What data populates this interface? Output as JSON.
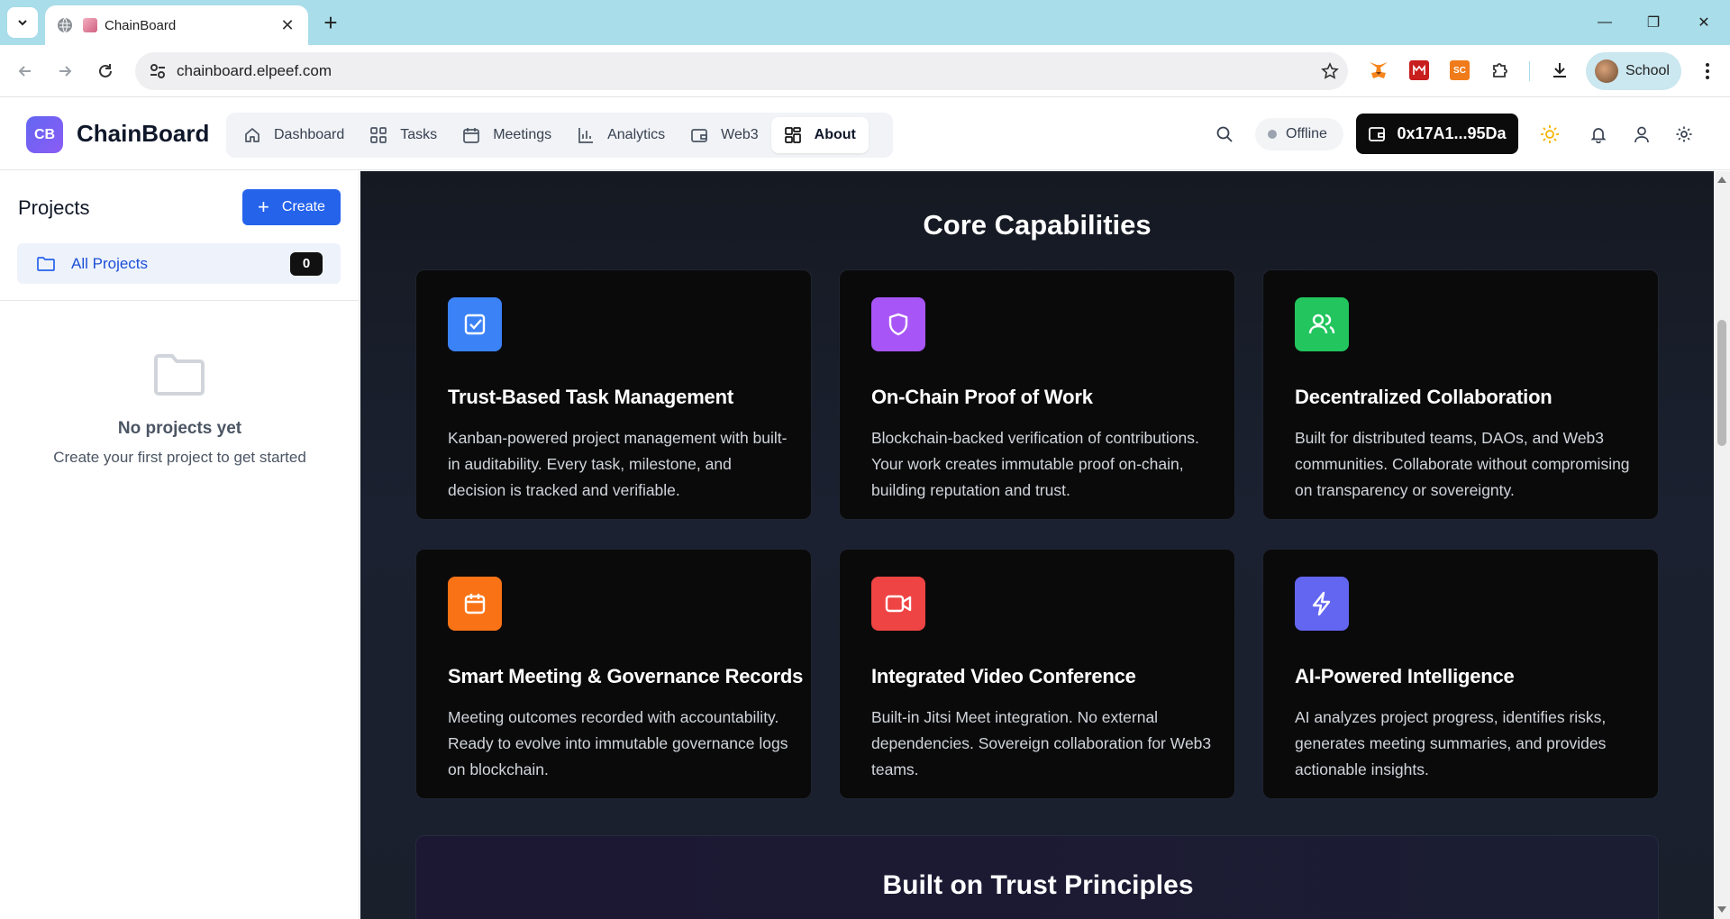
{
  "browser": {
    "tab_title": "ChainBoard",
    "url": "chainboard.elpeef.com",
    "profile_name": "School",
    "extensions": [
      {
        "name": "metamask-extension-icon",
        "label": ""
      },
      {
        "name": "red-extension-icon",
        "label": ""
      },
      {
        "name": "sc-extension-icon",
        "label": "SC"
      }
    ]
  },
  "header": {
    "logo_text": "CB",
    "brand": "ChainBoard",
    "nav": [
      {
        "label": "Dashboard",
        "icon": "home-icon"
      },
      {
        "label": "Tasks",
        "icon": "grid-icon"
      },
      {
        "label": "Meetings",
        "icon": "calendar-icon"
      },
      {
        "label": "Analytics",
        "icon": "bar-chart-icon"
      },
      {
        "label": "Web3",
        "icon": "wallet-icon"
      },
      {
        "label": "About",
        "icon": "layout-icon",
        "active": true
      }
    ],
    "status": "Offline",
    "wallet": "0x17A1...95Da"
  },
  "sidebar": {
    "title": "Projects",
    "create_label": "Create",
    "all_projects_label": "All Projects",
    "all_projects_count": "0",
    "empty_title": "No projects yet",
    "empty_subtitle": "Create your first project to get started"
  },
  "main": {
    "section_title": "Core Capabilities",
    "cards": [
      {
        "title": "Trust-Based Task Management",
        "desc": "Kanban-powered project management with built-in auditability. Every task, milestone, and decision is tracked and verifiable.",
        "icon": "check-square-icon",
        "color": "#3b82f6"
      },
      {
        "title": "On-Chain Proof of Work",
        "desc": "Blockchain-backed verification of contributions. Your work creates immutable proof on-chain, building reputation and trust.",
        "icon": "shield-icon",
        "color": "#a855f7"
      },
      {
        "title": "Decentralized Collaboration",
        "desc": "Built for distributed teams, DAOs, and Web3 communities. Collaborate without compromising on transparency or sovereignty.",
        "icon": "users-icon",
        "color": "#22c55e"
      },
      {
        "title": "Smart Meeting & Governance Records",
        "desc": "Meeting outcomes recorded with accountability. Ready to evolve into immutable governance logs on blockchain.",
        "icon": "calendar-icon",
        "color": "#f97316"
      },
      {
        "title": "Integrated Video Conference",
        "desc": "Built-in Jitsi Meet integration. No external dependencies. Sovereign collaboration for Web3 teams.",
        "icon": "video-icon",
        "color": "#ef4444"
      },
      {
        "title": "AI-Powered Intelligence",
        "desc": "AI analyzes project progress, identifies risks, generates meeting summaries, and provides actionable insights.",
        "icon": "zap-icon",
        "color": "#6366f1"
      }
    ],
    "principles_title": "Built on Trust Principles"
  }
}
